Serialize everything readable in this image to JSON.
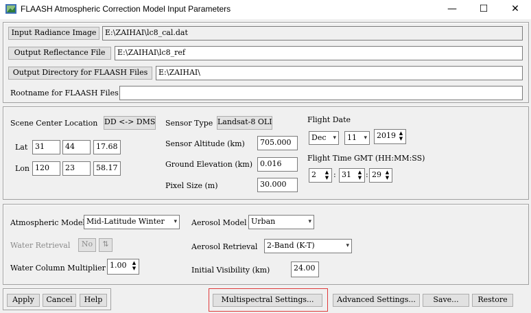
{
  "window": {
    "title": "FLAASH Atmospheric Correction Model Input Parameters",
    "minimize": "—",
    "maximize": "☐",
    "close": "✕"
  },
  "files": {
    "input_radiance_label": "Input Radiance Image",
    "input_radiance_value": "E:\\ZAIHAI\\lc8_cal.dat",
    "output_reflectance_label": "Output Reflectance File",
    "output_reflectance_value": "E:\\ZAIHAI\\lc8_ref",
    "output_directory_label": "Output Directory for FLAASH Files",
    "output_directory_value": "E:\\ZAIHAI\\",
    "rootname_label": "Rootname for FLAASH Files",
    "rootname_value": ""
  },
  "scene": {
    "center_location_label": "Scene Center Location",
    "dd_dms_button": "DD <-> DMS",
    "lat_label": "Lat",
    "lat": [
      "31",
      "44",
      "17.68"
    ],
    "lon_label": "Lon",
    "lon": [
      "120",
      "23",
      "58.17"
    ],
    "sensor_type_label": "Sensor Type",
    "sensor_type_value": "Landsat-8 OLI",
    "sensor_altitude_label": "Sensor Altitude (km)",
    "sensor_altitude_value": "705.000",
    "ground_elevation_label": "Ground Elevation (km)",
    "ground_elevation_value": "0.016",
    "pixel_size_label": "Pixel Size (m)",
    "pixel_size_value": "30.000",
    "flight_date_label": "Flight Date",
    "month": "Dec",
    "day": "11",
    "year": "2019",
    "flight_time_label": "Flight Time GMT (HH:MM:SS)",
    "hh": "2",
    "mm": "31",
    "ss": "29",
    "colon": ":"
  },
  "model": {
    "atmospheric_model_label": "Atmospheric Model",
    "atmospheric_model_value": "Mid-Latitude Winter",
    "water_retrieval_label": "Water Retrieval",
    "water_retrieval_value": "No",
    "water_column_label": "Water Column Multiplier",
    "water_column_value": "1.00",
    "aerosol_model_label": "Aerosol Model",
    "aerosol_model_value": "Urban",
    "aerosol_retrieval_label": "Aerosol Retrieval",
    "aerosol_retrieval_value": "2-Band (K-T)",
    "initial_visibility_label": "Initial Visibility (km)",
    "initial_visibility_value": "24.00"
  },
  "footer": {
    "apply": "Apply",
    "cancel": "Cancel",
    "help": "Help",
    "multispectral": "Multispectral Settings...",
    "advanced": "Advanced Settings...",
    "save": "Save...",
    "restore": "Restore"
  },
  "icons": {
    "dropdown": "▾",
    "spin_up": "▲",
    "spin_down": "▼",
    "toggle": "⇅"
  },
  "colors": {
    "highlight_border": "#e0393a"
  }
}
